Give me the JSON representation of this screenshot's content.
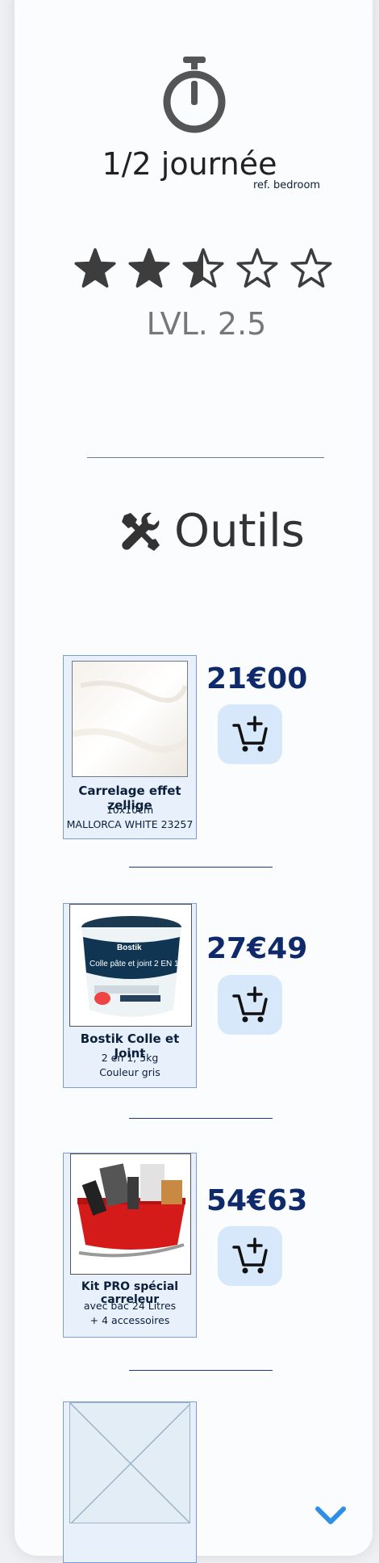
{
  "duration": {
    "label": "1/2 journée",
    "ref": "ref. bedroom",
    "icon": "stopwatch-icon"
  },
  "level": {
    "rating": 2.5,
    "max": 5,
    "label": "LVL. 2.5"
  },
  "tools": {
    "title": "Outils",
    "icon": "tools-icon"
  },
  "products": [
    {
      "name": "Carrelage effet zellige",
      "details": [
        "10x10cm",
        "MALLORCA WHITE 23257"
      ],
      "price": "21€00",
      "image": "white-tile-image"
    },
    {
      "name": "Bostik Colle et Joint",
      "details": [
        "2 en 1, 5kg",
        "Couleur gris"
      ],
      "price": "27€49",
      "image": "bostik-bucket-image",
      "image_text": [
        "Bostik",
        "Colle pâte et joint 2 EN 1"
      ]
    },
    {
      "name": "Kit PRO spécial carreleur",
      "details": [
        "avec bac 24 Litres",
        "+ 4 accessoires"
      ],
      "price": "54€63",
      "image": "tiler-kit-image"
    },
    {
      "image": "placeholder-image"
    }
  ],
  "colors": {
    "price": "#0f2a6b",
    "cart_button_bg": "#d7e8fb",
    "product_card_bg": "#e7f0fb",
    "product_card_border": "#7d9dd0",
    "scroll_arrow": "#2f8fe6"
  }
}
